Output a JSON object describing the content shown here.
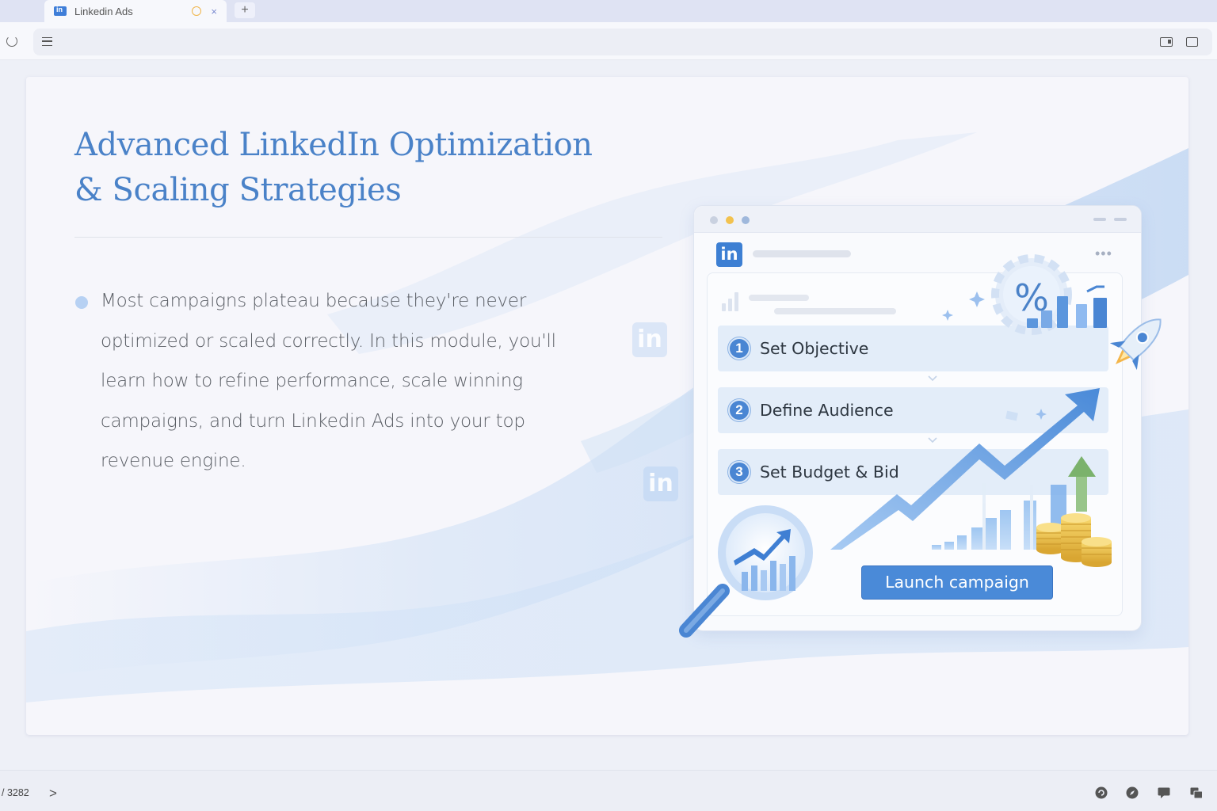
{
  "browser": {
    "tab_title": "Linkedin Ads",
    "new_tab_label": "+",
    "tab_close": "×"
  },
  "slide": {
    "title_line1": "Advanced LinkedIn Optimization",
    "title_line2": "& Scaling Strategies",
    "body": "Most campaigns plateau because they're never optimized or scaled correctly. In this module, you'll learn how to refine performance, scale winning campaigns, and turn Linkedin Ads into your top revenue engine.",
    "illustration": {
      "logo_text": "in",
      "steps": [
        {
          "num": "1",
          "label": "Set Objective"
        },
        {
          "num": "2",
          "label": "Define Audience"
        },
        {
          "num": "3",
          "label": "Set Budget & Bid"
        }
      ],
      "percent_symbol": "%",
      "launch_button": "Launch campaign"
    },
    "watermark_text": "in"
  },
  "statusbar": {
    "page_counter": "/ 3282",
    "next_symbol": ">"
  },
  "colors": {
    "title_blue": "#4a82c8",
    "accent_blue": "#4a8ad8",
    "light_blue": "#b7d1f3"
  }
}
